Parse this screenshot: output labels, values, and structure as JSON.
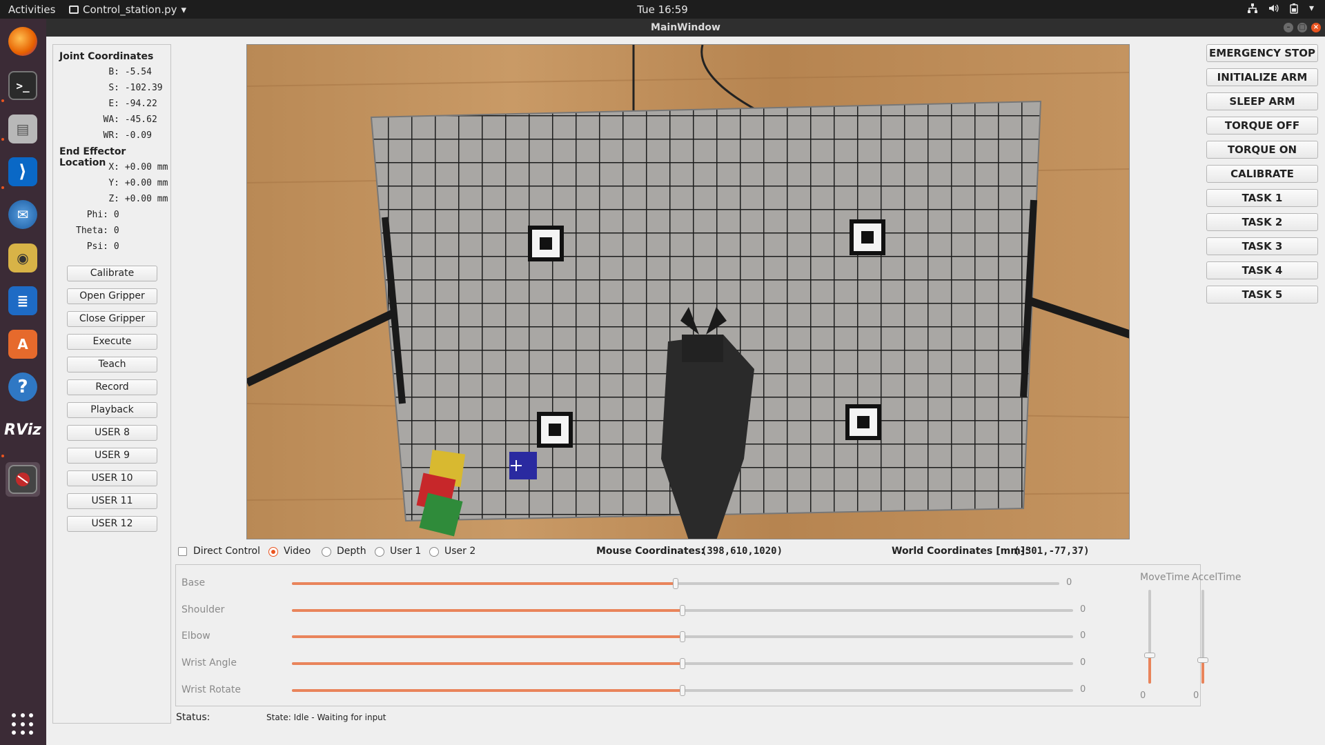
{
  "topbar": {
    "activities": "Activities",
    "app_name": "Control_station.py",
    "clock": "Tue 16:59"
  },
  "dock": {
    "items": [
      {
        "name": "firefox-icon"
      },
      {
        "name": "terminal-icon"
      },
      {
        "name": "file-cabinet-icon"
      },
      {
        "name": "vscode-icon"
      },
      {
        "name": "thunderbird-icon"
      },
      {
        "name": "rhythmbox-icon"
      },
      {
        "name": "writer-icon"
      },
      {
        "name": "software-center-icon"
      },
      {
        "name": "help-icon"
      },
      {
        "name": "rviz-icon",
        "label": "RViz"
      },
      {
        "name": "control-station-icon"
      }
    ]
  },
  "window": {
    "title": "MainWindow"
  },
  "left_panel": {
    "joint_title": "Joint Coordinates",
    "joints": [
      {
        "label": "B:",
        "value": "-5.54"
      },
      {
        "label": "S:",
        "value": "-102.39"
      },
      {
        "label": "E:",
        "value": "-94.22"
      },
      {
        "label": "WA:",
        "value": "-45.62"
      },
      {
        "label": "WR:",
        "value": "-0.09"
      }
    ],
    "ee_title": "End Effector Location",
    "ee": [
      {
        "label": "X:",
        "value": "+0.00 mm"
      },
      {
        "label": "Y:",
        "value": "+0.00 mm"
      },
      {
        "label": "Z:",
        "value": "+0.00 mm"
      },
      {
        "label": "Phi:",
        "value": "0"
      },
      {
        "label": "Theta:",
        "value": "0"
      },
      {
        "label": "Psi:",
        "value": "0"
      }
    ],
    "buttons": [
      "Calibrate",
      "Open Gripper",
      "Close Gripper",
      "Execute",
      "Teach",
      "Record",
      "Playback",
      "USER 8",
      "USER 9",
      "USER 10",
      "USER 11",
      "USER 12"
    ]
  },
  "controls": {
    "direct_control": "Direct Control",
    "video": "Video",
    "depth": "Depth",
    "user1": "User 1",
    "user2": "User 2",
    "selected_view": "Video",
    "mouse_label": "Mouse Coordinates:",
    "mouse_value": "(398,610,1020)",
    "world_label": "World Coordinates [mm]:",
    "world_value": "(-301,-77,37)"
  },
  "sliders": [
    {
      "label": "Base",
      "value": "0",
      "position": 0.5
    },
    {
      "label": "Shoulder",
      "value": "0",
      "position": 0.5
    },
    {
      "label": "Elbow",
      "value": "0",
      "position": 0.5
    },
    {
      "label": "Wrist Angle",
      "value": "0",
      "position": 0.5
    },
    {
      "label": "Wrist Rotate",
      "value": "0",
      "position": 0.5
    }
  ],
  "vertical_sliders": [
    {
      "label": "MoveTime",
      "value": "0",
      "position": 0.3
    },
    {
      "label": "AccelTime",
      "value": "0",
      "position": 0.25
    }
  ],
  "status": {
    "label": "Status:",
    "value": "State: Idle - Waiting for input"
  },
  "right_panel": {
    "buttons": [
      "EMERGENCY STOP",
      "INITIALIZE ARM",
      "SLEEP ARM",
      "TORQUE OFF",
      "TORQUE ON",
      "CALIBRATE",
      "TASK 1",
      "TASK 2",
      "TASK 3",
      "TASK 4",
      "TASK 5"
    ]
  },
  "colors": {
    "accent": "#e95420",
    "slider_fill": "#e9845b",
    "dock_bg": "#3b2b36"
  }
}
